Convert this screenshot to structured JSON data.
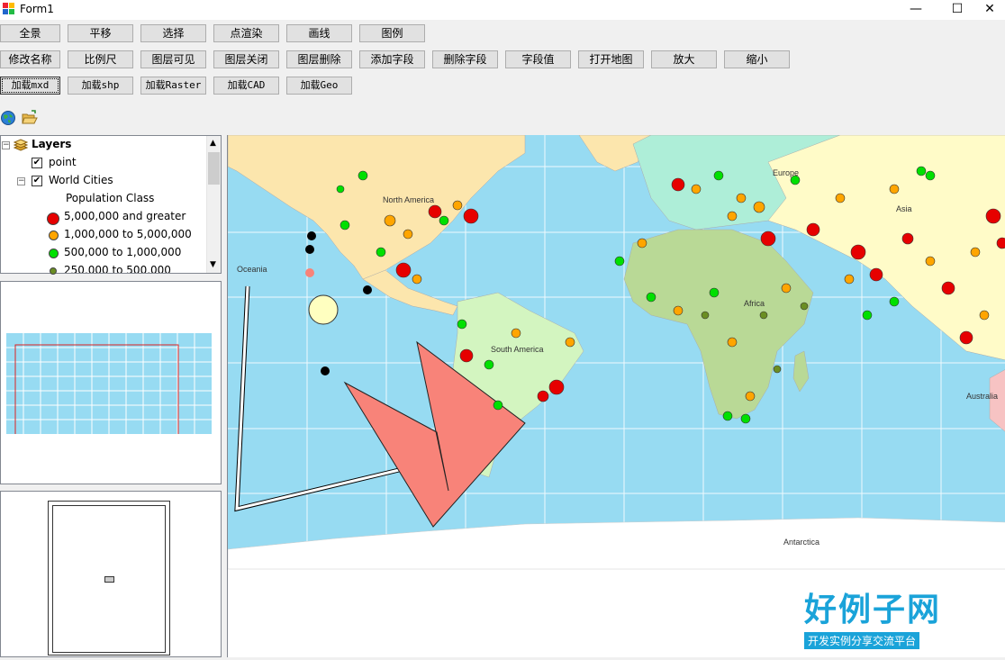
{
  "window": {
    "title": "Form1",
    "minimize": "—",
    "maximize": "☐",
    "close": "✕"
  },
  "toolbar": {
    "row1": [
      "全景",
      "平移",
      "选择",
      "点渲染",
      "画线",
      "图例"
    ],
    "row2": [
      "修改名称",
      "比例尺",
      "图层可见",
      "图层关闭",
      "图层删除",
      "添加字段",
      "删除字段",
      "字段值",
      "打开地图",
      "放大",
      "缩小"
    ],
    "row3": [
      "加载mxd",
      "加载shp",
      "加载Raster",
      "加载CAD",
      "加载Geo"
    ]
  },
  "icons": {
    "globe": "globe-icon",
    "open": "open-folder-icon"
  },
  "toc": {
    "root": "Layers",
    "layers": [
      {
        "name": "point",
        "checked": true
      },
      {
        "name": "World Cities",
        "checked": true
      }
    ],
    "legend_heading": "Population Class",
    "legend": [
      {
        "label": "5,000,000 and greater",
        "color": "#e60000"
      },
      {
        "label": "1,000,000 to 5,000,000",
        "color": "#ffa500"
      },
      {
        "label": "500,000 to 1,000,000",
        "color": "#00e000"
      },
      {
        "label": "250,000 to 500,000",
        "color": "#6b8e23"
      }
    ]
  },
  "map": {
    "labels": {
      "north_america": "North America",
      "south_america": "South America",
      "europe": "Europe",
      "asia": "Asia",
      "africa": "Africa",
      "australia": "Australia",
      "antarctica": "Antarctica",
      "oceania": "Oceania"
    },
    "colors": {
      "ocean": "#97dbf2",
      "land_na": "#fce6ad",
      "land_sa": "#d3f5c0",
      "land_af": "#b9d996",
      "land_asia": "#fffbc8",
      "polygon": "#f88379"
    }
  },
  "watermark": {
    "big": "好例子网",
    "small": "开发实例分享交流平台",
    "url": "www.haolizi.com"
  }
}
